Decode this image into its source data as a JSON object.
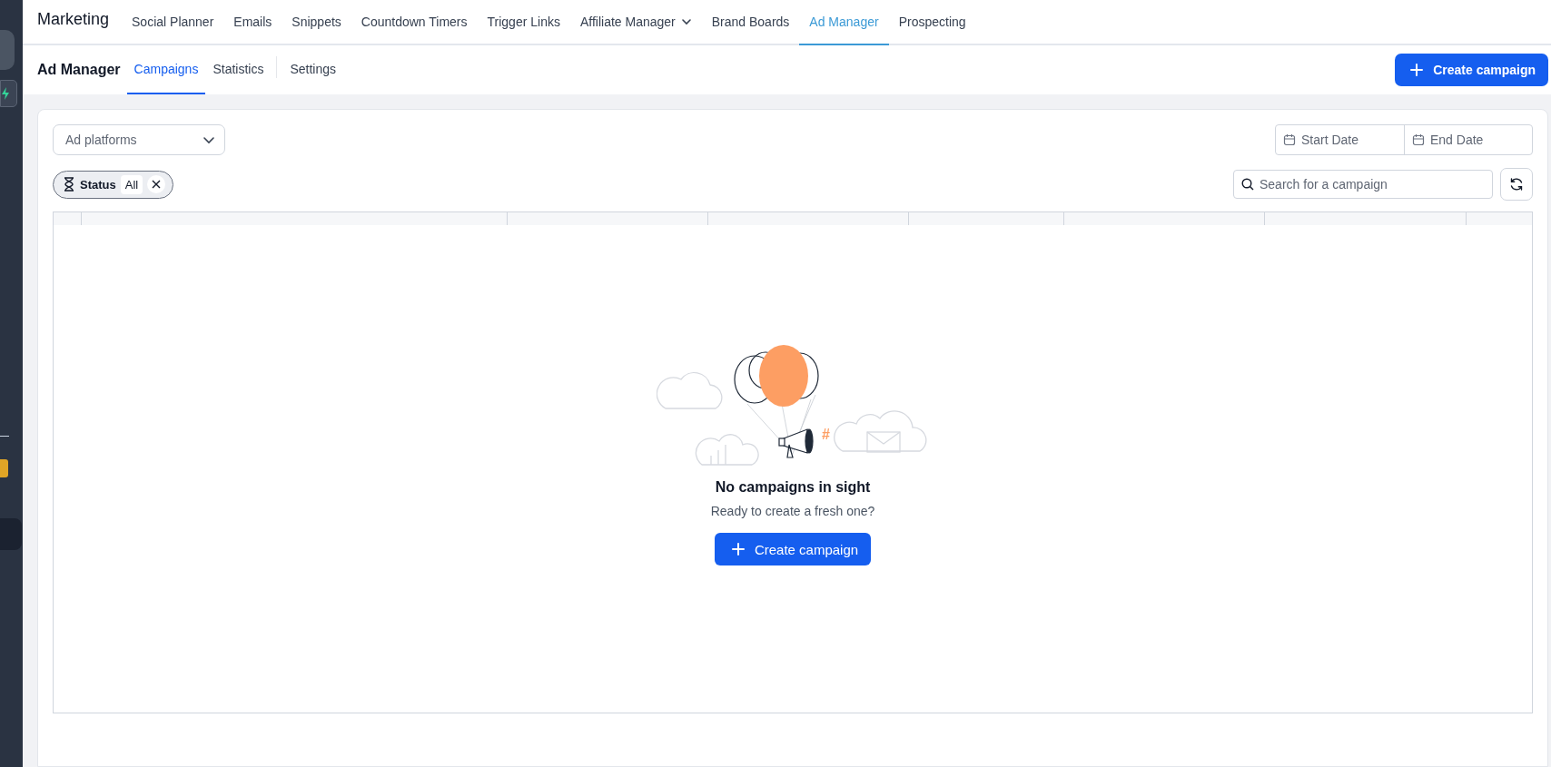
{
  "top_nav": {
    "title": "Marketing",
    "items": [
      {
        "label": "Social Planner",
        "kind": "link",
        "selected": false
      },
      {
        "label": "Emails",
        "kind": "link",
        "selected": false
      },
      {
        "label": "Snippets",
        "kind": "link",
        "selected": false
      },
      {
        "label": "Countdown Timers",
        "kind": "link",
        "selected": false
      },
      {
        "label": "Trigger Links",
        "kind": "link",
        "selected": false
      },
      {
        "label": "Affiliate Manager",
        "kind": "dropdown",
        "selected": false
      },
      {
        "label": "Brand Boards",
        "kind": "link",
        "selected": false
      },
      {
        "label": "Ad Manager",
        "kind": "link",
        "selected": true
      },
      {
        "label": "Prospecting",
        "kind": "link",
        "selected": false
      }
    ]
  },
  "sub_nav": {
    "title": "Ad Manager",
    "tabs": [
      {
        "label": "Campaigns",
        "selected": true,
        "divider_before": false
      },
      {
        "label": "Statistics",
        "selected": false,
        "divider_before": false
      },
      {
        "label": "Settings",
        "selected": false,
        "divider_before": true
      }
    ],
    "create_button": "Create campaign"
  },
  "filters": {
    "platform_select": {
      "placeholder": "Ad platforms"
    },
    "start_date": {
      "placeholder": "Start Date"
    },
    "end_date": {
      "placeholder": "End Date"
    },
    "status_chip": {
      "label": "Status",
      "value": "All"
    },
    "search": {
      "placeholder": "Search for a campaign"
    }
  },
  "empty_state": {
    "mark": "#",
    "title": "No campaigns in sight",
    "subtitle": "Ready to create a fresh one?",
    "button": "Create campaign"
  }
}
